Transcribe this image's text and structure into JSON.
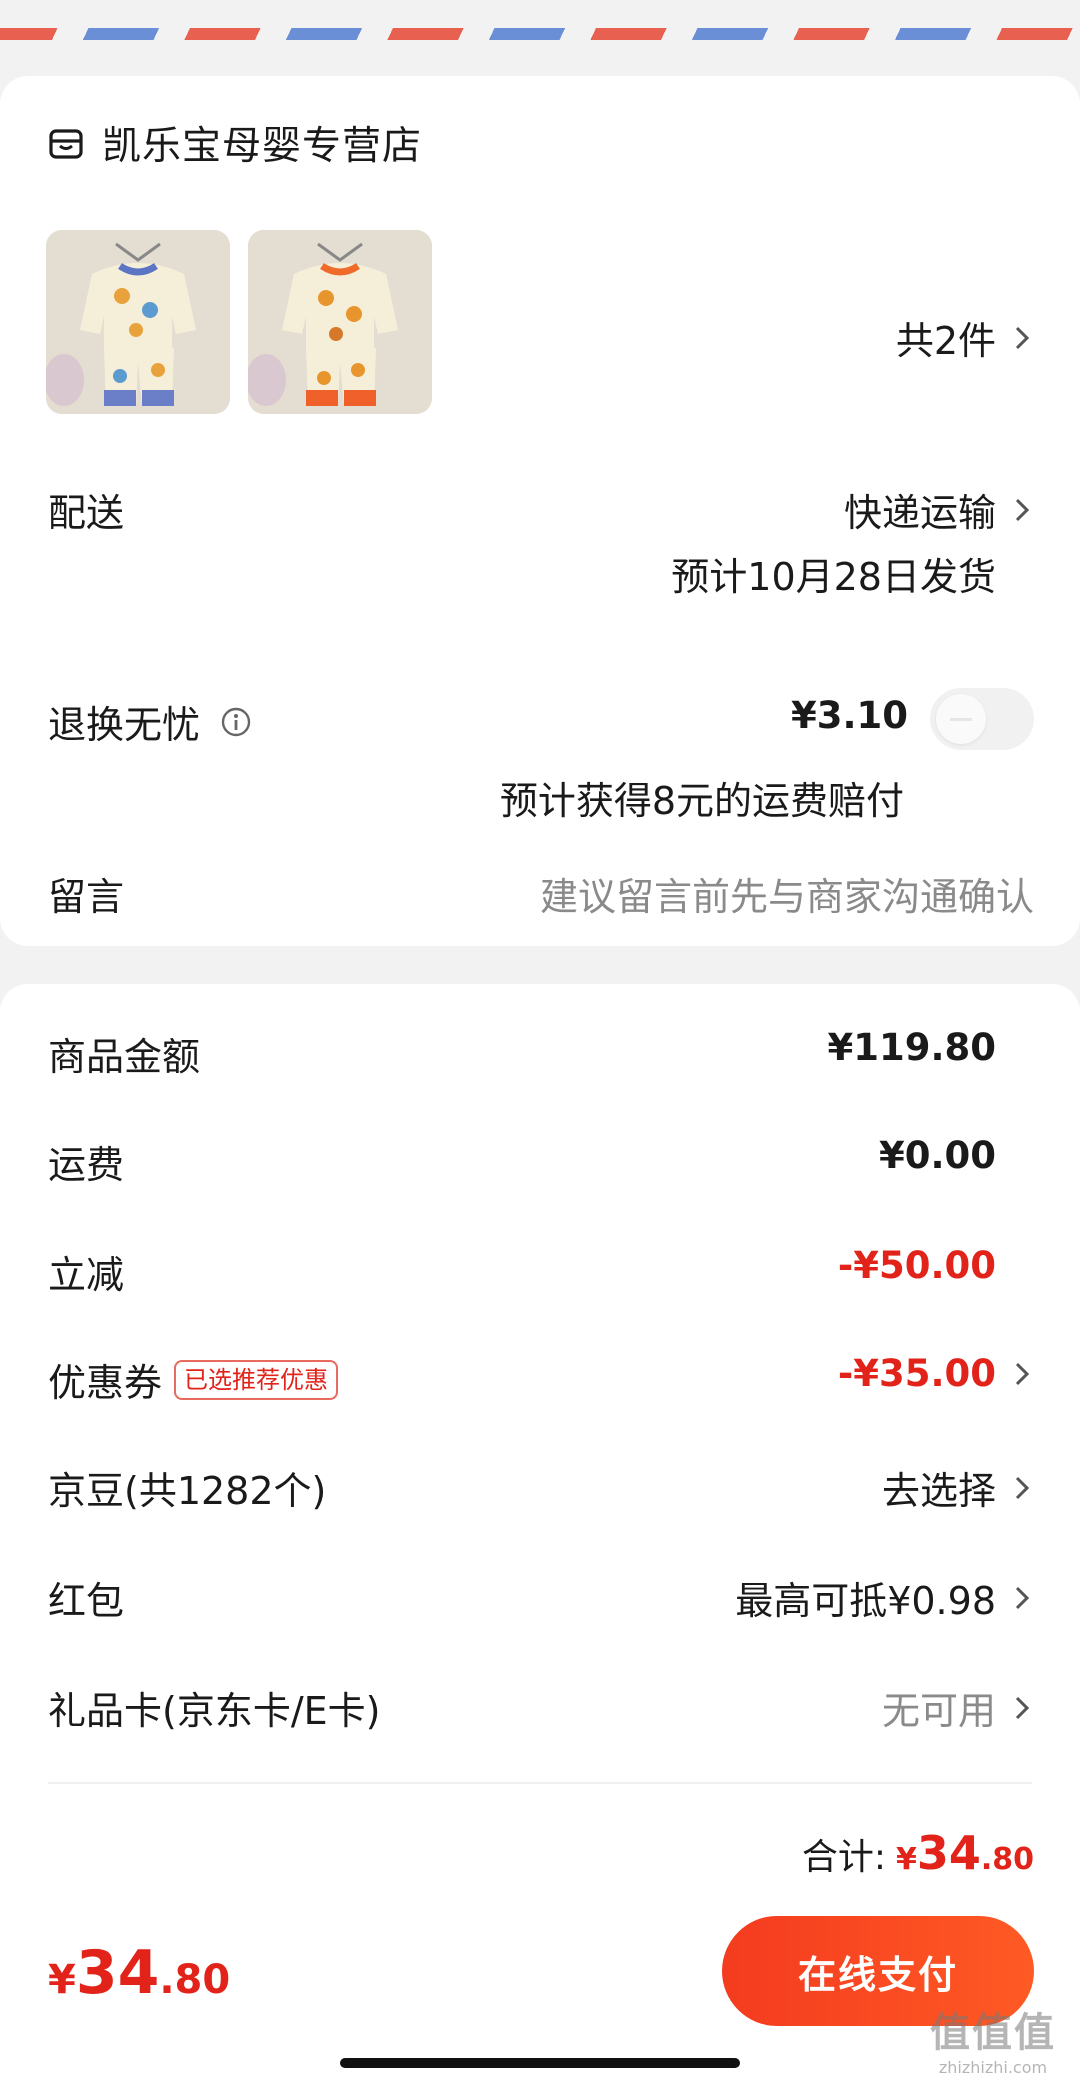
{
  "store": {
    "name": "凯乐宝母婴专营店",
    "icon": "store-icon"
  },
  "items": {
    "count_label": "共2件"
  },
  "delivery": {
    "label": "配送",
    "method": "快递运输",
    "estimate": "预计10月28日发货"
  },
  "return_insurance": {
    "label": "退换无忧",
    "price": "¥3.10",
    "note": "预计获得8元的运费赔付",
    "enabled": false
  },
  "message": {
    "label": "留言",
    "placeholder": "建议留言前先与商家沟通确认"
  },
  "summary": {
    "goods_label": "商品金额",
    "goods_value": "¥119.80",
    "shipping_label": "运费",
    "shipping_value": "¥0.00",
    "discount_label": "立减",
    "discount_value": "-¥50.00",
    "coupon_label": "优惠券",
    "coupon_badge": "已选推荐优惠",
    "coupon_value": "-¥35.00",
    "beans_label": "京豆(共1282个)",
    "beans_value": "去选择",
    "redpacket_label": "红包",
    "redpacket_value": "最高可抵¥0.98",
    "giftcard_label": "礼品卡(京东卡/E卡)",
    "giftcard_value": "无可用",
    "total_label": "合计:",
    "total_symbol": "¥",
    "total_int": "34",
    "total_dec": ".80"
  },
  "pay_bar": {
    "symbol": "¥",
    "int": "34",
    "dec": ".80",
    "button_label": "在线支付"
  },
  "watermark": {
    "main": "值值值",
    "sub": "zhizhizhi.com"
  },
  "colors": {
    "accent_red": "#e2231a",
    "button_start": "#f43b1f",
    "button_end": "#ff5a24"
  }
}
